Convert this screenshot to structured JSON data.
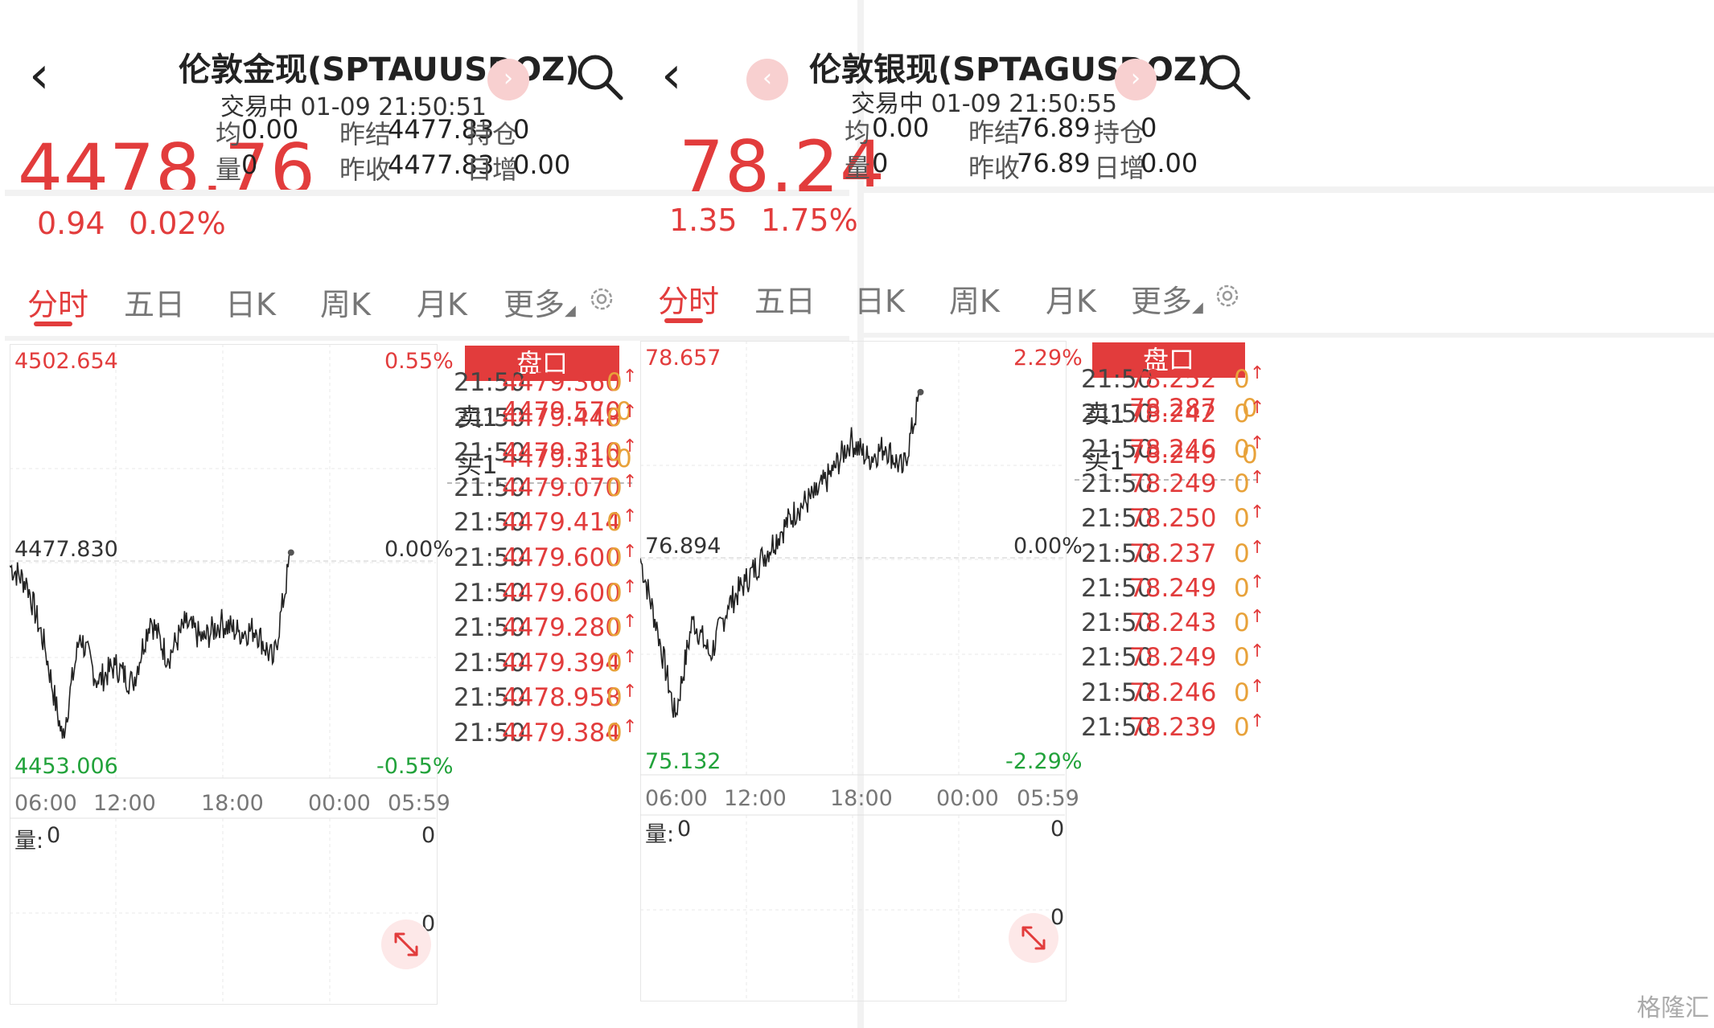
{
  "left": {
    "title": "伦敦金现(SPTAUUSDOZ)",
    "status": "交易中 01-09 21:50:51",
    "price": "4478.76",
    "change": "0.94",
    "change_pct": "0.02%",
    "quote": {
      "avg_label": "均",
      "avg": "0.00",
      "vol_label": "量",
      "vol": "0",
      "prev_settle_label": "昨结",
      "prev_settle": "4477.83",
      "prev_close_label": "昨收",
      "prev_close": "4477.83",
      "position_label": "持仓",
      "position": "0",
      "daily_inc_label": "日增",
      "daily_inc": "0.00"
    },
    "tabs": [
      "分时",
      "五日",
      "日K",
      "周K",
      "月K",
      "更多"
    ],
    "chart": {
      "high": "4502.654",
      "high_pct": "0.55%",
      "mid": "4477.830",
      "mid_pct": "0.00%",
      "low": "4453.006",
      "low_pct": "-0.55%",
      "times": [
        "06:00",
        "12:00",
        "18:00",
        "00:00",
        "05:59"
      ],
      "vol_label": "量:",
      "vol_value": "0",
      "vol_max": "0",
      "vol_min": "0"
    },
    "book": {
      "title": "盘口",
      "sell_label": "卖1",
      "sell_price": "4479.570",
      "sell_vol": "0",
      "buy_label": "买1",
      "buy_price": "4479.110",
      "buy_vol": "0",
      "ticks": [
        {
          "time": "21:50",
          "price": "4479.360",
          "vol": "0",
          "dir": "↑"
        },
        {
          "time": "21:50",
          "price": "4479.448",
          "vol": "0",
          "dir": "↑"
        },
        {
          "time": "21:50",
          "price": "4479.310",
          "vol": "0",
          "dir": "↑"
        },
        {
          "time": "21:50",
          "price": "4479.070",
          "vol": "0",
          "dir": "↑"
        },
        {
          "time": "21:50",
          "price": "4479.414",
          "vol": "0",
          "dir": "↑"
        },
        {
          "time": "21:50",
          "price": "4479.600",
          "vol": "0",
          "dir": "↑"
        },
        {
          "time": "21:50",
          "price": "4479.600",
          "vol": "0",
          "dir": "↑"
        },
        {
          "time": "21:50",
          "price": "4479.280",
          "vol": "0",
          "dir": "↑"
        },
        {
          "time": "21:50",
          "price": "4479.394",
          "vol": "0",
          "dir": "↑"
        },
        {
          "time": "21:50",
          "price": "4478.958",
          "vol": "0",
          "dir": "↑"
        },
        {
          "time": "21:50",
          "price": "4479.384",
          "vol": "0",
          "dir": "↑"
        }
      ]
    }
  },
  "right": {
    "title": "伦敦银现(SPTAGUSDOZ)",
    "status": "交易中 01-09 21:50:55",
    "price": "78.24",
    "change": "1.35",
    "change_pct": "1.75%",
    "quote": {
      "avg_label": "均",
      "avg": "0.00",
      "vol_label": "量",
      "vol": "0",
      "prev_settle_label": "昨结",
      "prev_settle": "76.89",
      "prev_close_label": "昨收",
      "prev_close": "76.89",
      "position_label": "持仓",
      "position": "0",
      "daily_inc_label": "日增",
      "daily_inc": "0.00"
    },
    "tabs": [
      "分时",
      "五日",
      "日K",
      "周K",
      "月K",
      "更多"
    ],
    "chart": {
      "high": "78.657",
      "high_pct": "2.29%",
      "mid": "76.894",
      "mid_pct": "0.00%",
      "low": "75.132",
      "low_pct": "-2.29%",
      "times": [
        "06:00",
        "12:00",
        "18:00",
        "00:00",
        "05:59"
      ],
      "vol_label": "量:",
      "vol_value": "0",
      "vol_max": "0",
      "vol_min": "0"
    },
    "book": {
      "title": "盘口",
      "sell_label": "卖1",
      "sell_price": "78.287",
      "sell_vol": "0",
      "buy_label": "买1",
      "buy_price": "78.249",
      "buy_vol": "0",
      "ticks": [
        {
          "time": "21:50",
          "price": "78.252",
          "vol": "0",
          "dir": "↑"
        },
        {
          "time": "21:50",
          "price": "78.242",
          "vol": "0",
          "dir": "↑"
        },
        {
          "time": "21:50",
          "price": "78.246",
          "vol": "0",
          "dir": "↑"
        },
        {
          "time": "21:50",
          "price": "78.249",
          "vol": "0",
          "dir": "↑"
        },
        {
          "time": "21:50",
          "price": "78.250",
          "vol": "0",
          "dir": "↑"
        },
        {
          "time": "21:50",
          "price": "78.237",
          "vol": "0",
          "dir": "↑"
        },
        {
          "time": "21:50",
          "price": "78.249",
          "vol": "0",
          "dir": "↑"
        },
        {
          "time": "21:50",
          "price": "78.243",
          "vol": "0",
          "dir": "↑"
        },
        {
          "time": "21:50",
          "price": "78.249",
          "vol": "0",
          "dir": "↑"
        },
        {
          "time": "21:50",
          "price": "78.246",
          "vol": "0",
          "dir": "↑"
        },
        {
          "time": "21:50",
          "price": "78.239",
          "vol": "0",
          "dir": "↑"
        }
      ]
    }
  },
  "watermark": "格隆汇",
  "colors": {
    "up": "#e23c3c",
    "down": "#21a23a",
    "line": "#222222"
  },
  "chart_data": [
    {
      "type": "line",
      "title": "伦敦金现(SPTAUUSDOZ)",
      "ylim": [
        4453.006,
        4502.654
      ],
      "x": [
        "06:00",
        "07:00",
        "08:00",
        "09:00",
        "10:00",
        "11:00",
        "12:00",
        "13:00",
        "14:00",
        "15:00",
        "16:00",
        "17:00",
        "18:00",
        "19:00",
        "20:00",
        "21:00",
        "21:50"
      ],
      "values": [
        4477.3,
        4475.2,
        4468.0,
        4457.5,
        4469.4,
        4464.0,
        4465.9,
        4463.8,
        4471.3,
        4466.7,
        4470.7,
        4468.8,
        4470.8,
        4469.7,
        4470.0,
        4466.3,
        4478.8
      ]
    },
    {
      "type": "line",
      "title": "伦敦银现(SPTAGUSDOZ)",
      "ylim": [
        75.132,
        78.657
      ],
      "x": [
        "06:00",
        "07:00",
        "08:00",
        "09:00",
        "10:00",
        "11:00",
        "12:00",
        "13:00",
        "14:00",
        "15:00",
        "16:00",
        "17:00",
        "18:00",
        "19:00",
        "20:00",
        "21:00",
        "21:50"
      ],
      "values": [
        76.89,
        76.3,
        75.6,
        76.4,
        76.1,
        76.5,
        76.7,
        76.9,
        77.1,
        77.3,
        77.4,
        77.6,
        77.85,
        77.7,
        77.8,
        77.6,
        78.24
      ]
    }
  ]
}
